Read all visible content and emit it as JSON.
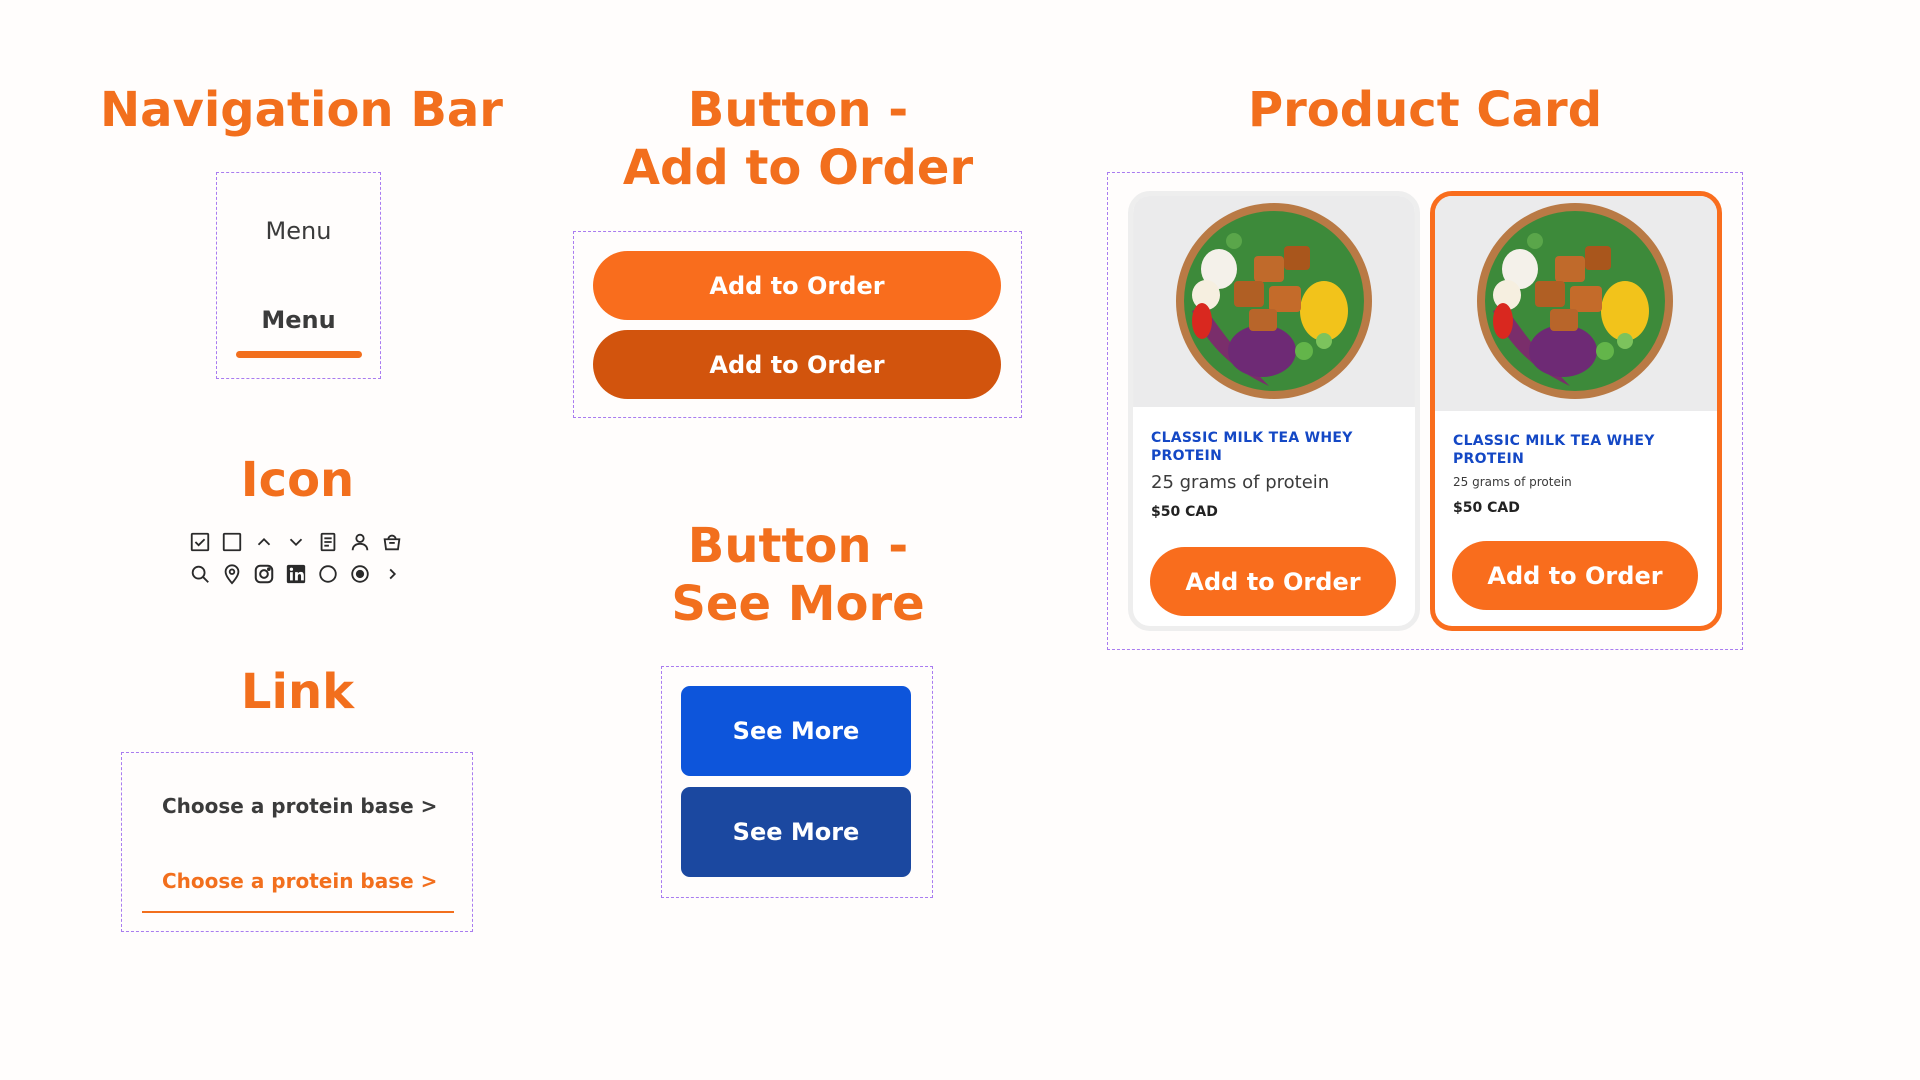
{
  "headings": {
    "nav": "Navigation Bar",
    "add_order_line1": "Button -",
    "add_order_line2": "Add to Order",
    "product_card": "Product Card",
    "icon": "Icon",
    "see_more_line1": "Button -",
    "see_more_line2": "See More",
    "link": "Link"
  },
  "nav": {
    "default_label": "Menu",
    "active_label": "Menu"
  },
  "icons": {
    "row1": [
      "checkbox-checked-icon",
      "checkbox-icon",
      "chevron-up-icon",
      "chevron-down-icon",
      "document-icon",
      "user-icon",
      "shopping-bag-icon"
    ],
    "row2": [
      "search-icon",
      "location-pin-icon",
      "instagram-icon",
      "linkedin-icon",
      "radio-unselected-icon",
      "radio-selected-icon",
      "chevron-right-icon"
    ]
  },
  "link": {
    "default_label": "Choose a protein base >",
    "active_label": "Choose a protein base >"
  },
  "add_order": {
    "default_label": "Add to Order",
    "pressed_label": "Add to Order"
  },
  "see_more": {
    "default_label": "See More",
    "pressed_label": "See More"
  },
  "product_cards": [
    {
      "title": "CLASSIC MILK TEA WHEY PROTEIN",
      "subtitle": "25 grams of protein",
      "price": "$50 CAD",
      "button": "Add to Order"
    },
    {
      "title": "CLASSIC MILK TEA WHEY PROTEIN",
      "subtitle": "25 grams of protein",
      "price": "$50 CAD",
      "button": "Add to Order"
    }
  ],
  "colors": {
    "accent_orange": "#f26f1d",
    "button_orange": "#f96d1d",
    "button_orange_pressed": "#d2540d",
    "button_blue": "#0d55db",
    "button_blue_pressed": "#1b48a0",
    "frame_dashed": "#a97cf0",
    "card_title_blue": "#1448c5"
  }
}
